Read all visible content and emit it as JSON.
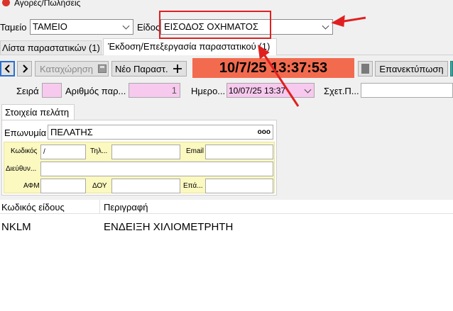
{
  "window": {
    "title": "Αγορές/Πωλήσεις"
  },
  "filters": {
    "tameio_label": "Ταμείο",
    "tameio_value": "ΤΑΜΕΙΟ",
    "eidos_label": "Είδος",
    "eidos_value": "ΕΙΣΟΔΟΣ ΟΧΗΜΑΤΟΣ"
  },
  "tabs": [
    {
      "label": "Λίστα παραστατικών (1)"
    },
    {
      "label": "Έκδοση/Επεξεργασία παραστατικού (1)"
    }
  ],
  "toolbar": {
    "save_label": "Καταχώρηση",
    "new_label": "Νέο Παραστ.",
    "datetime": "10/7/25 13:37:53",
    "reprint_label": "Επανεκτύπωση"
  },
  "header_fields": {
    "seira_label": "Σειρά",
    "arithmos_label": "Αριθμός παρ...",
    "arithmos_value": "1",
    "date_label": "Ημερο...",
    "date_value": "10/07/25 13:37",
    "related_label": "Σχετ.Π..."
  },
  "customer": {
    "tab_label": "Στοιχεία πελάτη",
    "name_label": "Επωνυμία",
    "name_value": "ΠΕΛΑΤΗΣ",
    "more_glyph": "ooo",
    "code_label": "Κωδικός",
    "code_value": "/",
    "phone_label": "Τηλ...",
    "email_label": "Email",
    "address_label": "Διεύθυν...",
    "afm_label": "ΑΦΜ",
    "doy_label": "ΔΟΥ",
    "profession_label": "Επά..."
  },
  "items_table": {
    "columns": [
      "Κωδικός είδους",
      "Περιγραφή"
    ],
    "rows": [
      {
        "code": "NKLM",
        "description": "ΕΝΔΕΙΞΗ ΧΙΛΙΟΜΕΤΡΗΤΗ"
      }
    ]
  },
  "colors": {
    "datetime_bg": "#f26b4f",
    "highlight_box": "#e02020",
    "pink_field": "#f7c9ee",
    "yellow_panel": "#fbf8c0"
  },
  "icons": [
    "app-icon",
    "chevron-down-icon",
    "arrow-left-icon",
    "arrow-right-icon",
    "save-icon",
    "plus-icon",
    "ellipsis-icon"
  ]
}
